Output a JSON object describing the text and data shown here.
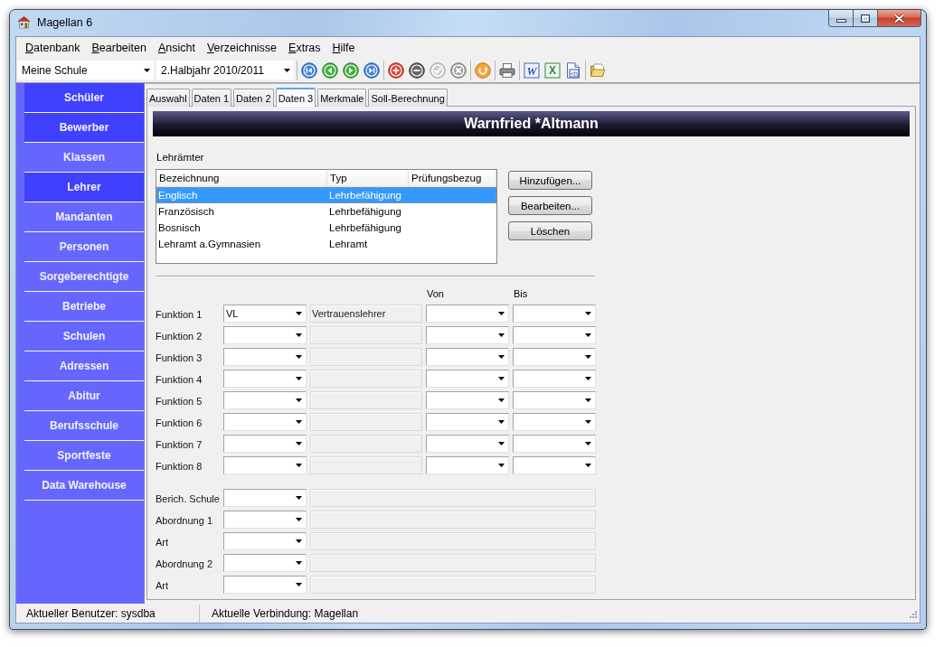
{
  "window": {
    "title": "Magellan 6"
  },
  "menu": [
    "Datenbank",
    "Bearbeiten",
    "Ansicht",
    "Verzeichnisse",
    "Extras",
    "Hilfe"
  ],
  "toolbar": {
    "selectors": [
      {
        "value": "Meine Schule"
      },
      {
        "value": "2.Halbjahr 2010/2011"
      }
    ],
    "button_groups": [
      [
        {
          "kind": "first",
          "disabled": false
        },
        {
          "kind": "previous",
          "disabled": false
        },
        {
          "kind": "next",
          "disabled": false
        },
        {
          "kind": "last",
          "disabled": false
        }
      ],
      [
        {
          "kind": "add",
          "disabled": false
        },
        {
          "kind": "remove",
          "disabled": false
        },
        {
          "kind": "confirm",
          "disabled": true
        },
        {
          "kind": "cancel",
          "disabled": true
        }
      ],
      [
        {
          "kind": "refresh",
          "disabled": false
        }
      ],
      [
        {
          "kind": "print",
          "disabled": false
        }
      ],
      [
        {
          "kind": "word_document",
          "glyph": "W",
          "disabled": false
        },
        {
          "kind": "spreadsheet",
          "glyph": "X",
          "disabled": false
        },
        {
          "kind": "html_document",
          "glyph": "<h",
          "disabled": false
        }
      ],
      [
        {
          "kind": "folder",
          "disabled": false
        }
      ]
    ]
  },
  "sidebar": {
    "items": [
      {
        "label": "Schüler",
        "selected": true
      },
      {
        "label": "Bewerber",
        "selected": true
      },
      {
        "label": "Klassen",
        "selected": false
      },
      {
        "label": "Lehrer",
        "selected": true
      },
      {
        "label": "Mandanten",
        "selected": false
      },
      {
        "label": "Personen",
        "selected": false
      },
      {
        "label": "Sorgeberechtigte",
        "selected": false
      },
      {
        "label": "Betriebe",
        "selected": false
      },
      {
        "label": "Schulen",
        "selected": false
      },
      {
        "label": "Adressen",
        "selected": false
      },
      {
        "label": "Abitur",
        "selected": false
      },
      {
        "label": "Berufsschule",
        "selected": false
      },
      {
        "label": "Sportfeste",
        "selected": false
      },
      {
        "label": "Data Warehouse",
        "selected": false
      }
    ]
  },
  "tabs": [
    {
      "label": "Auswahl",
      "selected": false
    },
    {
      "label": "Daten 1",
      "selected": false
    },
    {
      "label": "Daten 2",
      "selected": false
    },
    {
      "label": "Daten 3",
      "selected": true
    },
    {
      "label": "Merkmale",
      "selected": false
    },
    {
      "label": "Soll-Berechnung",
      "selected": false
    }
  ],
  "record_header": {
    "title": "Warnfried *Altmann"
  },
  "lehraemter": {
    "label": "Lehrämter",
    "columns": [
      "Bezeichnung",
      "Typ",
      "Prüfungsbezug"
    ],
    "rows": [
      {
        "cells": [
          "Englisch",
          "Lehrbefähigung"
        ],
        "selected": true
      },
      {
        "cells": [
          "Französisch",
          "Lehrbefähigung"
        ],
        "selected": false
      },
      {
        "cells": [
          "Bosnisch",
          "Lehrbefähigung"
        ],
        "selected": false
      },
      {
        "cells": [
          "Lehramt a.Gymnasien",
          "Lehramt"
        ],
        "selected": false
      }
    ],
    "buttons": [
      "Hinzufügen...",
      "Bearbeiten...",
      "Löschen"
    ]
  },
  "functions": {
    "column_headers": [
      "Von",
      "Bis"
    ],
    "rows": [
      {
        "label": "Funktion 1",
        "value": "VL",
        "description": "Vertrauenslehrer"
      },
      {
        "label": "Funktion 2"
      },
      {
        "label": "Funktion 3"
      },
      {
        "label": "Funktion 4"
      },
      {
        "label": "Funktion 5"
      },
      {
        "label": "Funktion 6"
      },
      {
        "label": "Funktion 7"
      },
      {
        "label": "Funktion 8"
      }
    ]
  },
  "assignments": [
    {
      "label": "Berich. Schule"
    },
    {
      "label": "Abordnung 1"
    },
    {
      "label": "Art"
    },
    {
      "label": "Abordnung 2"
    },
    {
      "label": "Art"
    }
  ],
  "status_bar": [
    "Aktueller Benutzer: sysdba",
    "Aktuelle Verbindung: Magellan"
  ]
}
